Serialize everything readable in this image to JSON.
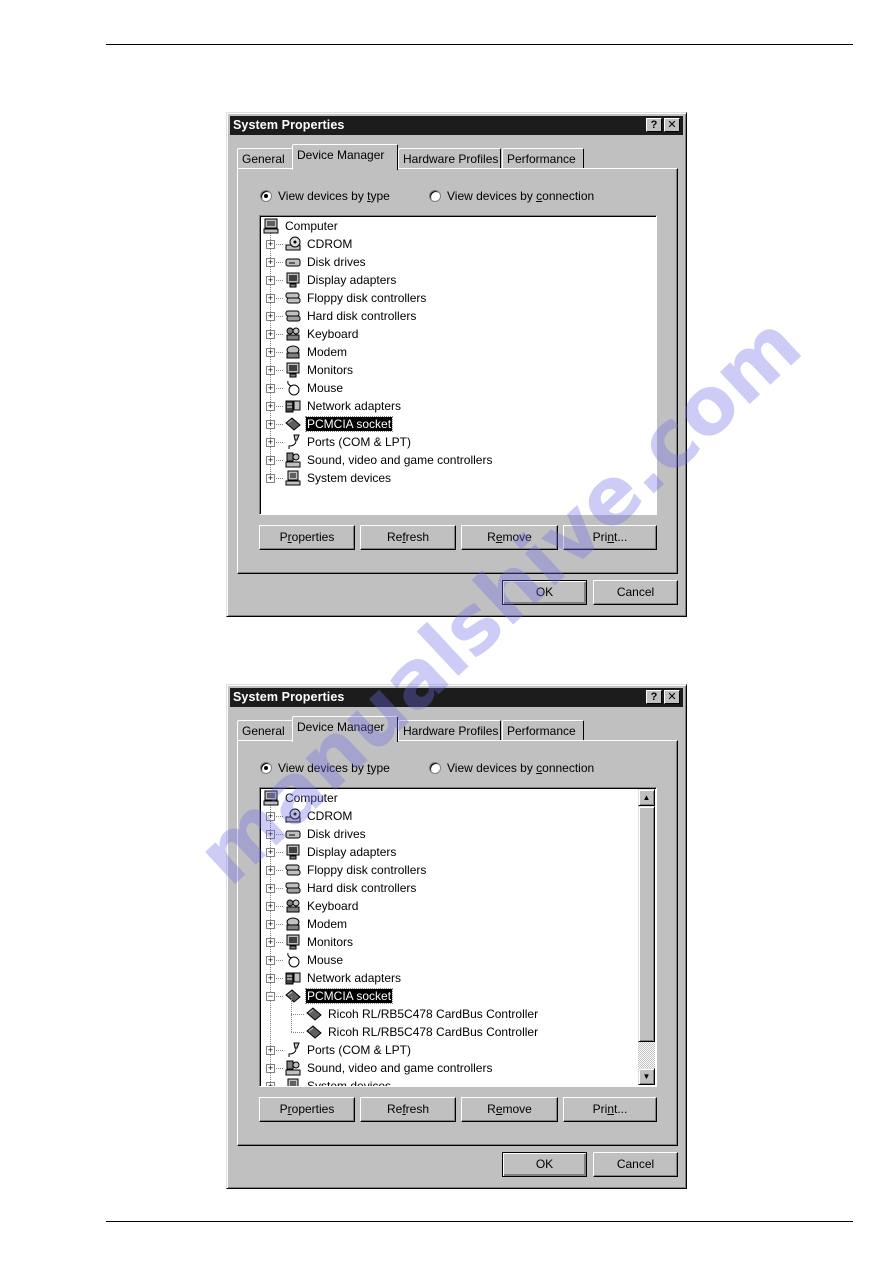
{
  "page": {
    "watermark": "manualshive.com"
  },
  "dialogs": [
    {
      "title": "System Properties",
      "title_buttons": {
        "help": "?",
        "close": "✕"
      },
      "tabs": [
        {
          "label": "General",
          "active": false
        },
        {
          "label": "Device Manager",
          "active": true
        },
        {
          "label": "Hardware Profiles",
          "active": false
        },
        {
          "label": "Performance",
          "active": false
        }
      ],
      "view_options": {
        "by_type": {
          "prefix": "View devices by ",
          "accel": "t",
          "suffix": "ype",
          "checked": true
        },
        "by_connection": {
          "prefix": "View devices by ",
          "accel": "c",
          "suffix": "onnection",
          "checked": false
        }
      },
      "tree": [
        {
          "label": "Computer",
          "icon": "computer-icon",
          "level": 0,
          "expander": ""
        },
        {
          "label": "CDROM",
          "icon": "cdrom-icon",
          "level": 1,
          "expander": "+"
        },
        {
          "label": "Disk drives",
          "icon": "disk-drive-icon",
          "level": 1,
          "expander": "+"
        },
        {
          "label": "Display adapters",
          "icon": "display-adapter-icon",
          "level": 1,
          "expander": "+"
        },
        {
          "label": "Floppy disk controllers",
          "icon": "floppy-controller-icon",
          "level": 1,
          "expander": "+"
        },
        {
          "label": "Hard disk controllers",
          "icon": "hard-disk-controller-icon",
          "level": 1,
          "expander": "+"
        },
        {
          "label": "Keyboard",
          "icon": "keyboard-icon",
          "level": 1,
          "expander": "+"
        },
        {
          "label": "Modem",
          "icon": "modem-icon",
          "level": 1,
          "expander": "+"
        },
        {
          "label": "Monitors",
          "icon": "monitor-icon",
          "level": 1,
          "expander": "+"
        },
        {
          "label": "Mouse",
          "icon": "mouse-icon",
          "level": 1,
          "expander": "+"
        },
        {
          "label": "Network adapters",
          "icon": "network-adapter-icon",
          "level": 1,
          "expander": "+"
        },
        {
          "label": "PCMCIA socket",
          "icon": "pcmcia-card-icon",
          "level": 1,
          "expander": "+",
          "selected": true
        },
        {
          "label": "Ports (COM & LPT)",
          "icon": "port-connector-icon",
          "level": 1,
          "expander": "+"
        },
        {
          "label": "Sound, video and game controllers",
          "icon": "sound-controller-icon",
          "level": 1,
          "expander": "+"
        },
        {
          "label": "System devices",
          "icon": "system-device-icon",
          "level": 1,
          "expander": "+"
        }
      ],
      "scrollbar": null,
      "buttons": {
        "properties": {
          "pre": "P",
          "accel": "r",
          "post": "operties"
        },
        "refresh": {
          "pre": "Re",
          "accel": "f",
          "post": "resh"
        },
        "remove": {
          "pre": "R",
          "accel": "e",
          "post": "move"
        },
        "print": {
          "pre": "Pri",
          "accel": "n",
          "post": "t..."
        },
        "ok": "OK",
        "cancel": "Cancel"
      }
    },
    {
      "title": "System Properties",
      "title_buttons": {
        "help": "?",
        "close": "✕"
      },
      "tabs": [
        {
          "label": "General",
          "active": false
        },
        {
          "label": "Device Manager",
          "active": true
        },
        {
          "label": "Hardware Profiles",
          "active": false
        },
        {
          "label": "Performance",
          "active": false
        }
      ],
      "view_options": {
        "by_type": {
          "prefix": "View devices by ",
          "accel": "t",
          "suffix": "ype",
          "checked": true
        },
        "by_connection": {
          "prefix": "View devices by ",
          "accel": "c",
          "suffix": "onnection",
          "checked": false
        }
      },
      "tree": [
        {
          "label": "Computer",
          "icon": "computer-icon",
          "level": 0,
          "expander": ""
        },
        {
          "label": "CDROM",
          "icon": "cdrom-icon",
          "level": 1,
          "expander": "+"
        },
        {
          "label": "Disk drives",
          "icon": "disk-drive-icon",
          "level": 1,
          "expander": "+"
        },
        {
          "label": "Display adapters",
          "icon": "display-adapter-icon",
          "level": 1,
          "expander": "+"
        },
        {
          "label": "Floppy disk controllers",
          "icon": "floppy-controller-icon",
          "level": 1,
          "expander": "+"
        },
        {
          "label": "Hard disk controllers",
          "icon": "hard-disk-controller-icon",
          "level": 1,
          "expander": "+"
        },
        {
          "label": "Keyboard",
          "icon": "keyboard-icon",
          "level": 1,
          "expander": "+"
        },
        {
          "label": "Modem",
          "icon": "modem-icon",
          "level": 1,
          "expander": "+"
        },
        {
          "label": "Monitors",
          "icon": "monitor-icon",
          "level": 1,
          "expander": "+"
        },
        {
          "label": "Mouse",
          "icon": "mouse-icon",
          "level": 1,
          "expander": "+"
        },
        {
          "label": "Network adapters",
          "icon": "network-adapter-icon",
          "level": 1,
          "expander": "+"
        },
        {
          "label": "PCMCIA socket",
          "icon": "pcmcia-card-icon",
          "level": 1,
          "expander": "−",
          "selected": true
        },
        {
          "label": "Ricoh RL/RB5C478 CardBus Controller",
          "icon": "pcmcia-card-icon",
          "level": 2,
          "expander": ""
        },
        {
          "label": "Ricoh RL/RB5C478 CardBus Controller",
          "icon": "pcmcia-card-icon",
          "level": 2,
          "expander": ""
        },
        {
          "label": "Ports (COM & LPT)",
          "icon": "port-connector-icon",
          "level": 1,
          "expander": "+"
        },
        {
          "label": "Sound, video and game controllers",
          "icon": "sound-controller-icon",
          "level": 1,
          "expander": "+"
        },
        {
          "label": "System devices",
          "icon": "system-device-icon",
          "level": 1,
          "expander": "+"
        }
      ],
      "scrollbar": {
        "position": 0.0,
        "visible_fraction": 0.9,
        "up": "▲",
        "down": "▼"
      },
      "buttons": {
        "properties": {
          "pre": "P",
          "accel": "r",
          "post": "operties"
        },
        "refresh": {
          "pre": "Re",
          "accel": "f",
          "post": "resh"
        },
        "remove": {
          "pre": "R",
          "accel": "e",
          "post": "move"
        },
        "print": {
          "pre": "Pri",
          "accel": "n",
          "post": "t..."
        },
        "ok": "OK",
        "cancel": "Cancel"
      }
    }
  ]
}
